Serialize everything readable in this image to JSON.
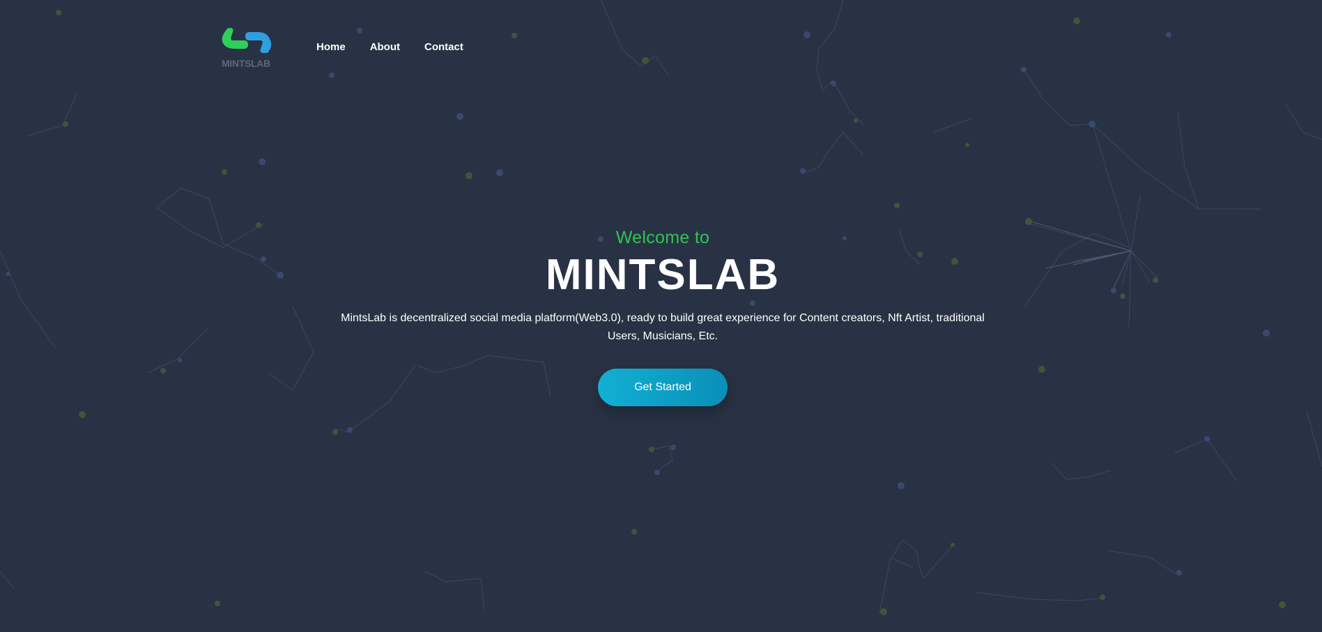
{
  "brand": {
    "logo_text": "MINTSLAB",
    "colors": {
      "logo_green": "#2fd05a",
      "logo_blue": "#2f9fe0",
      "background": "#283244",
      "accent_green": "#2fc553",
      "button": "#0fa6cc"
    }
  },
  "nav": {
    "items": [
      {
        "label": "Home"
      },
      {
        "label": "About"
      },
      {
        "label": "Contact"
      }
    ]
  },
  "hero": {
    "welcome": "Welcome to",
    "title": "MINTSLAB",
    "description": "MintsLab is decentralized social media platform(Web3.0), ready to build great experience for Content creators, Nft Artist, traditional Users, Musicians, Etc.",
    "cta_label": "Get Started"
  }
}
